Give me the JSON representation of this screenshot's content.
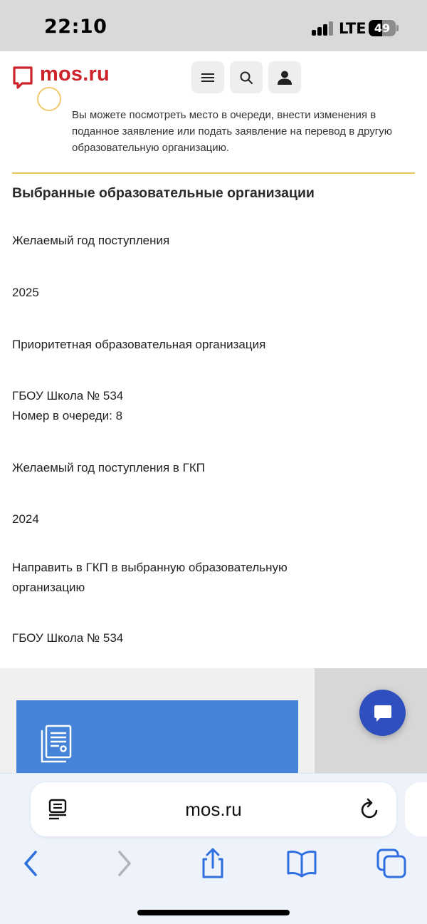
{
  "status_bar": {
    "time": "22:10",
    "network": "LTE",
    "battery_level": "49"
  },
  "header": {
    "logo_text": "mos.ru",
    "brand_color": "#cc2229",
    "icons": [
      "menu-icon",
      "search-icon",
      "user-icon"
    ]
  },
  "content": {
    "notice": "Вы можете посмотреть место в очереди, внести изменения в поданное заявление или подать заявление на перевод в другую образовательную организацию.",
    "section_title": "Выбранные образовательные организации",
    "fields": [
      {
        "label": "Желаемый год поступления",
        "value": "2025"
      },
      {
        "label": "Приоритетная образовательная организация",
        "value": "ГБОУ Школа № 534",
        "extra": "Номер в очереди: 8"
      },
      {
        "label": "Желаемый год поступления в ГКП",
        "value": "2024"
      },
      {
        "label": "Направить в ГКП в выбранную образовательную организацию",
        "value": "ГБОУ Школа № 534"
      }
    ],
    "divider_color": "#e9c25a"
  },
  "widgets": {
    "card_icon": "document-icon",
    "card_color": "#4584d9",
    "chat_icon": "chat-icon",
    "chat_color": "#2e4fbd"
  },
  "browser": {
    "url": "mos.ru",
    "toolbar": [
      "back-icon",
      "forward-icon",
      "share-icon",
      "bookmarks-icon",
      "tabs-icon"
    ]
  }
}
